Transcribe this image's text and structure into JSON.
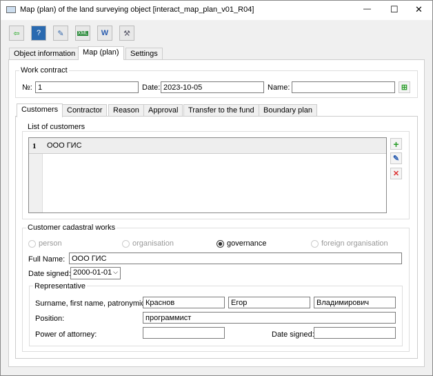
{
  "window": {
    "title": "Map (plan) of the land surveying object [interact_map_plan_v01_R04]",
    "minimize": "—",
    "maximize": "☐",
    "close": "✕"
  },
  "toolbar": [
    {
      "icon": "exit-icon",
      "glyph": "⇦"
    },
    {
      "icon": "help-icon",
      "glyph": "?"
    },
    {
      "icon": "edit-document-icon",
      "glyph": "✎"
    },
    {
      "icon": "xml-export-icon",
      "glyph": "XML"
    },
    {
      "icon": "word-export-icon",
      "glyph": "W"
    },
    {
      "icon": "survey-tool-icon",
      "glyph": "⚒"
    }
  ],
  "main_tabs": [
    {
      "label": "Object information"
    },
    {
      "label": "Map (plan)"
    },
    {
      "label": "Settings"
    }
  ],
  "work_contract": {
    "title": "Work contract",
    "number_label": "№:",
    "number": "1",
    "date_label": "Date:",
    "date": "2023-10-05",
    "name_label": "Name:",
    "name": ""
  },
  "sub_tabs": [
    {
      "label": "Customers"
    },
    {
      "label": "Contractor"
    },
    {
      "label": "Reason"
    },
    {
      "label": "Approval"
    },
    {
      "label": "Transfer to the fund"
    },
    {
      "label": "Boundary plan"
    }
  ],
  "customers": {
    "title": "List of customers",
    "rows": [
      {
        "index": "1",
        "name": "ООО ГИС"
      }
    ]
  },
  "cadastral": {
    "title": "Customer cadastral works",
    "types": [
      {
        "label": "person",
        "selected": false
      },
      {
        "label": "organisation",
        "selected": false
      },
      {
        "label": "governance",
        "selected": true
      },
      {
        "label": "foreign organisation",
        "selected": false
      }
    ],
    "full_name_label": "Full Name:",
    "full_name": "ООО ГИС",
    "date_signed_label": "Date signed:",
    "date_signed": "2000-01-01"
  },
  "representative": {
    "title": "Representative",
    "fio_label": "Surname, first name, patronymic:",
    "surname": "Краснов",
    "first_name": "Егор",
    "patronymic": "Владимирович",
    "position_label": "Position:",
    "position": "программист",
    "attorney_label": "Power of attorney:",
    "attorney": "",
    "date_signed_label": "Date signed:",
    "date_signed": ""
  },
  "colors": {
    "add": "#2a9d2a",
    "edit": "#2a5db0",
    "delete": "#d33"
  }
}
